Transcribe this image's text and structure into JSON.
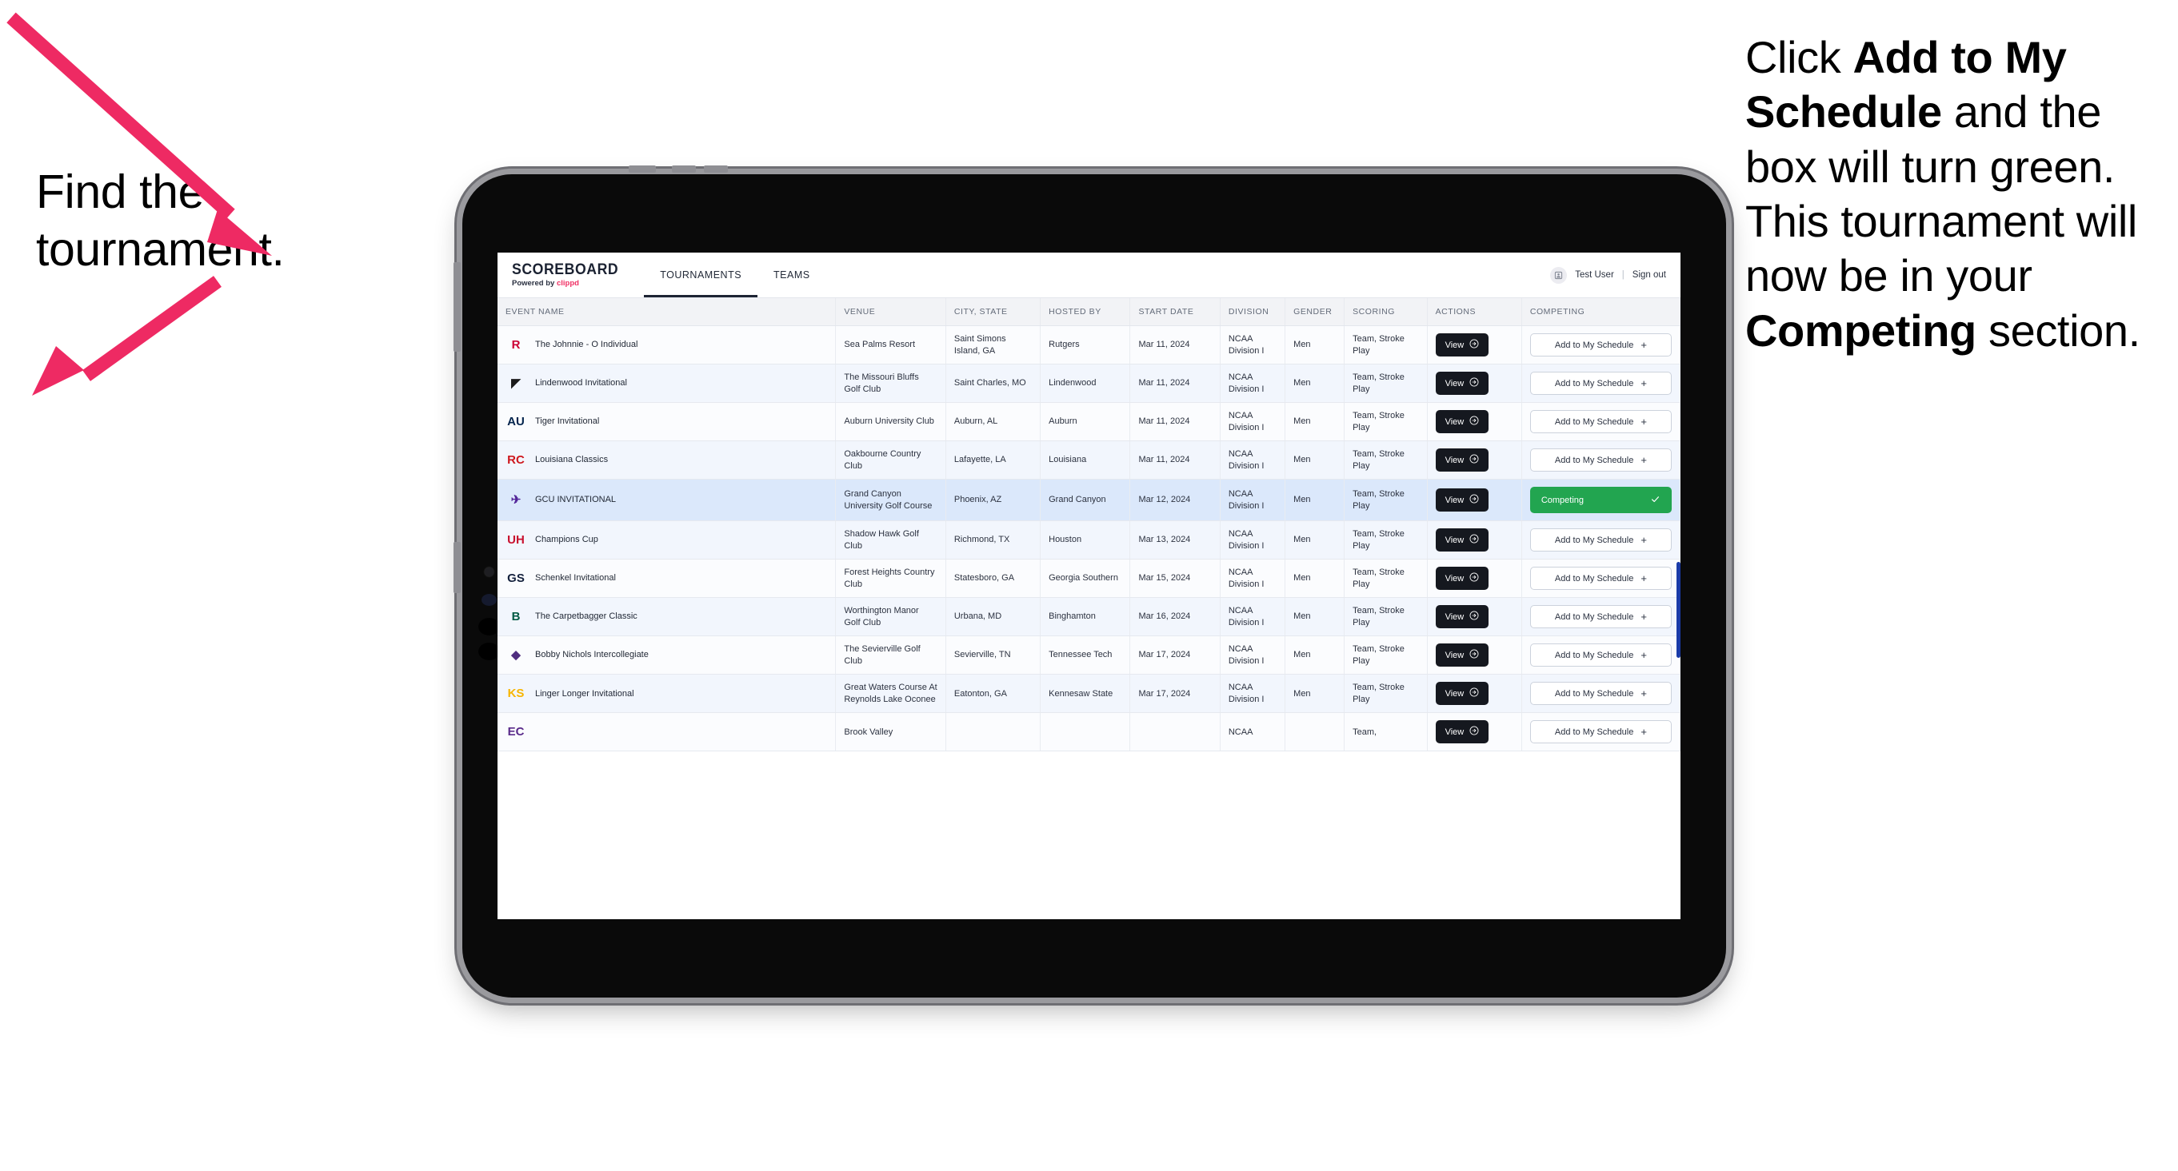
{
  "annotations": {
    "left": "Find the tournament.",
    "right_parts": [
      {
        "text": "Click ",
        "bold": false
      },
      {
        "text": "Add to My Schedule",
        "bold": true
      },
      {
        "text": " and the box will turn green. This tournament will now be in your ",
        "bold": false
      },
      {
        "text": "Competing",
        "bold": true
      },
      {
        "text": " section.",
        "bold": false
      }
    ],
    "arrow_color": "#ee2a63"
  },
  "app": {
    "brand": {
      "title": "SCOREBOARD",
      "powered_prefix": "Powered by ",
      "powered_brand": "clippd",
      "brand_accent": "#ef2f63"
    },
    "nav": [
      {
        "label": "TOURNAMENTS",
        "active": true
      },
      {
        "label": "TEAMS",
        "active": false
      }
    ],
    "user": {
      "avatar_icon": "user-avatar-icon",
      "name": "Test User",
      "separator": "|",
      "sign_out": "Sign out"
    },
    "table": {
      "columns": [
        "EVENT NAME",
        "VENUE",
        "CITY, STATE",
        "HOSTED BY",
        "START DATE",
        "DIVISION",
        "GENDER",
        "SCORING",
        "ACTIONS",
        "COMPETING"
      ],
      "view_label": "View",
      "view_icon": "arrow-circle-right-icon",
      "add_label": "Add to My Schedule",
      "add_icon": "plus-icon",
      "competing_label": "Competing",
      "competing_icon": "check-icon",
      "competing_color": "#22a550",
      "rows": [
        {
          "logo": "rutgers-logo",
          "logo_text": "R",
          "logo_color": "#cc0033",
          "event": "The Johnnie - O Individual",
          "venue": "Sea Palms Resort",
          "city": "Saint Simons Island, GA",
          "host": "Rutgers",
          "date": "Mar 11, 2024",
          "division": "NCAA Division I",
          "gender": "Men",
          "scoring": "Team, Stroke Play",
          "competing": false
        },
        {
          "logo": "lindenwood-logo",
          "logo_text": "◤",
          "logo_color": "#1b1b1b",
          "event": "Lindenwood Invitational",
          "venue": "The Missouri Bluffs Golf Club",
          "city": "Saint Charles, MO",
          "host": "Lindenwood",
          "date": "Mar 11, 2024",
          "division": "NCAA Division I",
          "gender": "Men",
          "scoring": "Team, Stroke Play",
          "competing": false
        },
        {
          "logo": "auburn-logo",
          "logo_text": "AU",
          "logo_color": "#03244d",
          "event": "Tiger Invitational",
          "venue": "Auburn University Club",
          "city": "Auburn, AL",
          "host": "Auburn",
          "date": "Mar 11, 2024",
          "division": "NCAA Division I",
          "gender": "Men",
          "scoring": "Team, Stroke Play",
          "competing": false
        },
        {
          "logo": "louisiana-ragin-cajuns-logo",
          "logo_text": "RC",
          "logo_color": "#ce181e",
          "event": "Louisiana Classics",
          "venue": "Oakbourne Country Club",
          "city": "Lafayette, LA",
          "host": "Louisiana",
          "date": "Mar 11, 2024",
          "division": "NCAA Division I",
          "gender": "Men",
          "scoring": "Team, Stroke Play",
          "competing": false
        },
        {
          "logo": "grand-canyon-lopes-logo",
          "logo_text": "✈",
          "logo_color": "#522398",
          "event": "GCU INVITATIONAL",
          "venue": "Grand Canyon University Golf Course",
          "city": "Phoenix, AZ",
          "host": "Grand Canyon",
          "date": "Mar 12, 2024",
          "division": "NCAA Division I",
          "gender": "Men",
          "scoring": "Team, Stroke Play",
          "competing": true,
          "selected": true
        },
        {
          "logo": "houston-cougars-logo",
          "logo_text": "UH",
          "logo_color": "#c8102e",
          "event": "Champions Cup",
          "venue": "Shadow Hawk Golf Club",
          "city": "Richmond, TX",
          "host": "Houston",
          "date": "Mar 13, 2024",
          "division": "NCAA Division I",
          "gender": "Men",
          "scoring": "Team, Stroke Play",
          "competing": false
        },
        {
          "logo": "georgia-southern-eagles-logo",
          "logo_text": "GS",
          "logo_color": "#14213d",
          "event": "Schenkel Invitational",
          "venue": "Forest Heights Country Club",
          "city": "Statesboro, GA",
          "host": "Georgia Southern",
          "date": "Mar 15, 2024",
          "division": "NCAA Division I",
          "gender": "Men",
          "scoring": "Team, Stroke Play",
          "competing": false
        },
        {
          "logo": "binghamton-bearcats-logo",
          "logo_text": "B",
          "logo_color": "#005a43",
          "event": "The Carpetbagger Classic",
          "venue": "Worthington Manor Golf Club",
          "city": "Urbana, MD",
          "host": "Binghamton",
          "date": "Mar 16, 2024",
          "division": "NCAA Division I",
          "gender": "Men",
          "scoring": "Team, Stroke Play",
          "competing": false
        },
        {
          "logo": "tennessee-tech-golden-eagles-logo",
          "logo_text": "◆",
          "logo_color": "#4f2d7f",
          "event": "Bobby Nichols Intercollegiate",
          "venue": "The Sevierville Golf Club",
          "city": "Sevierville, TN",
          "host": "Tennessee Tech",
          "date": "Mar 17, 2024",
          "division": "NCAA Division I",
          "gender": "Men",
          "scoring": "Team, Stroke Play",
          "competing": false
        },
        {
          "logo": "kennesaw-state-owls-logo",
          "logo_text": "KS",
          "logo_color": "#f7b500",
          "event": "Linger Longer Invitational",
          "venue": "Great Waters Course At Reynolds Lake Oconee",
          "city": "Eatonton, GA",
          "host": "Kennesaw State",
          "date": "Mar 17, 2024",
          "division": "NCAA Division I",
          "gender": "Men",
          "scoring": "Team, Stroke Play",
          "competing": false
        },
        {
          "logo": "east-carolina-pirates-logo",
          "logo_text": "EC",
          "logo_color": "#592a8a",
          "event": "",
          "venue": "Brook Valley",
          "city": "",
          "host": "",
          "date": "",
          "division": "NCAA",
          "gender": "",
          "scoring": "Team,",
          "competing": false,
          "clipped": true
        }
      ]
    }
  }
}
